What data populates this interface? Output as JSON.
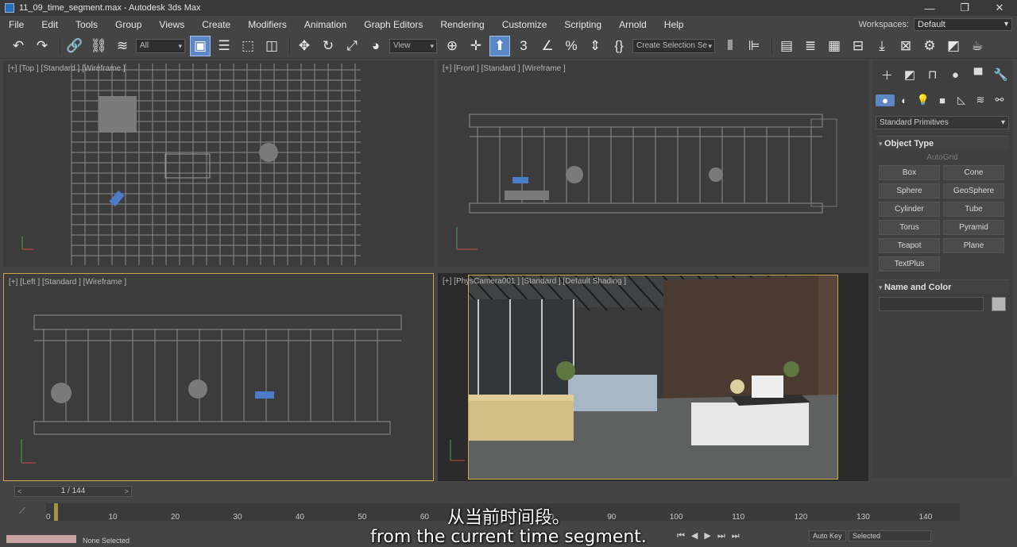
{
  "window": {
    "title": "11_09_time_segment.max - Autodesk 3ds Max",
    "minimize": "—",
    "maximize": "❐",
    "close": "✕"
  },
  "menu": {
    "items": [
      "File",
      "Edit",
      "Tools",
      "Group",
      "Views",
      "Create",
      "Modifiers",
      "Animation",
      "Graph Editors",
      "Rendering",
      "Customize",
      "Scripting",
      "Arnold",
      "Help"
    ],
    "workspaces_label": "Workspaces:",
    "workspace_value": "Default"
  },
  "toolbar": {
    "filter_value": "All",
    "refcoord_value": "View",
    "selection_set_value": "Create Selection Se"
  },
  "viewports": {
    "top": {
      "label": "[+] [Top ] [Standard ] [Wireframe ]"
    },
    "front": {
      "label": "[+] [Front ] [Standard ] [Wireframe ]"
    },
    "left": {
      "label": "[+] [Left ] [Standard ] [Wireframe ]"
    },
    "camera": {
      "label": "[+] [PhysCamera001 ] [Standard ] [Default Shading ]"
    }
  },
  "command_panel": {
    "category_value": "Standard Primitives",
    "object_type_title": "Object Type",
    "autogrid_label": "AutoGrid",
    "buttons": [
      "Box",
      "Cone",
      "Sphere",
      "GeoSphere",
      "Cylinder",
      "Tube",
      "Torus",
      "Pyramid",
      "Teapot",
      "Plane",
      "TextPlus"
    ],
    "name_color_title": "Name and Color",
    "swatch_color": "#b5b5b5"
  },
  "timeline": {
    "frame_readout": "1 / 144",
    "prev_arrow": "<",
    "next_arrow": ">",
    "current_frame": 1,
    "total_frames": 144,
    "ticks": [
      "0",
      "10",
      "20",
      "30",
      "40",
      "50",
      "60",
      "70",
      "80",
      "90",
      "100",
      "110",
      "120",
      "130",
      "140"
    ]
  },
  "status": {
    "selection_text": "None Selected",
    "auto_key": "Auto Key",
    "selected": "Selected"
  },
  "subtitles": {
    "chinese": "从当前时间段。",
    "english": "from the current time segment."
  }
}
